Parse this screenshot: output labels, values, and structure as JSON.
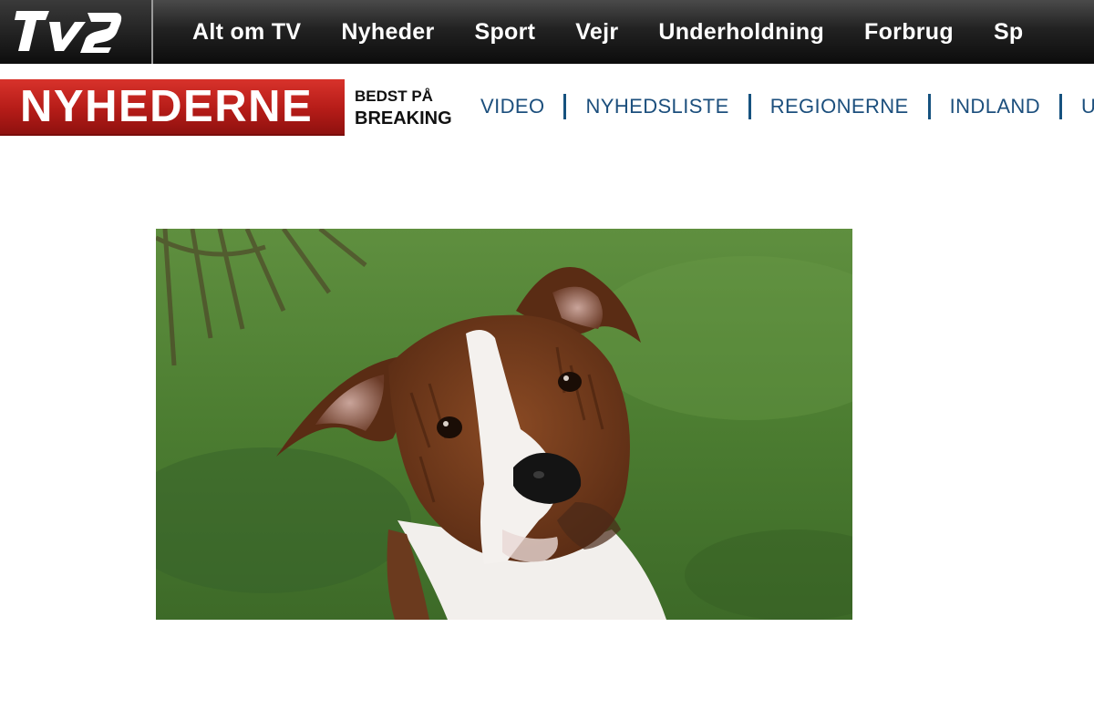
{
  "top_nav": {
    "logo_text": "TV2",
    "items": [
      "Alt om TV",
      "Nyheder",
      "Sport",
      "Vejr",
      "Underholdning",
      "Forbrug",
      "Sp"
    ]
  },
  "section_header": {
    "logo_text": "NYHEDERNE",
    "tagline_line1": "BEDST PÅ",
    "tagline_line2": "BREAKING",
    "links": [
      "VIDEO",
      "NYHEDSLISTE",
      "REGIONERNE",
      "INDLAND",
      "UDL"
    ]
  },
  "article": {
    "image_subject": "brindle-puppy-photo"
  },
  "colors": {
    "topbar": "#1a1a1a",
    "nyhederne_red": "#c0211c",
    "nav_link_blue": "#1c4f7d",
    "separator_blue": "#16527f"
  }
}
